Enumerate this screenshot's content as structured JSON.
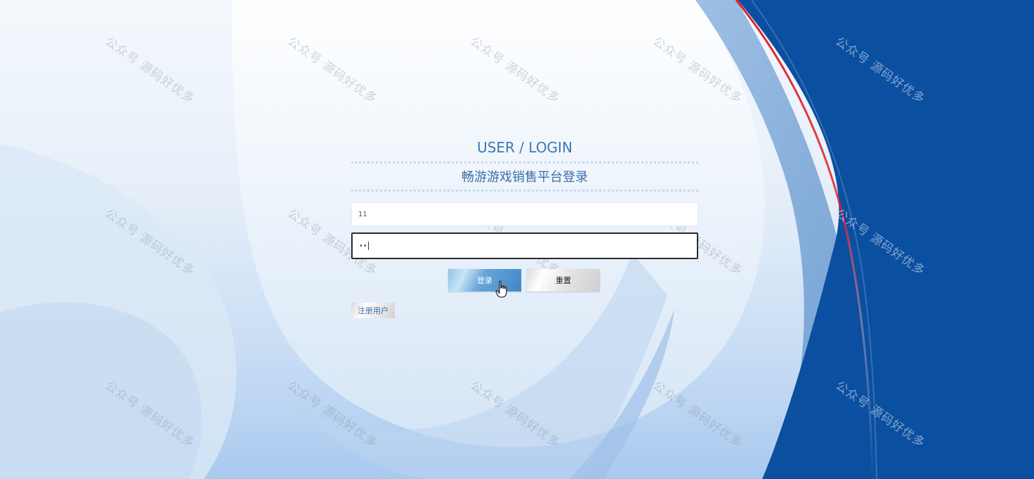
{
  "login": {
    "title_en": "USER / LOGIN",
    "title_cn": "畅游游戏销售平台登录",
    "username_value": "11",
    "password_value": "••",
    "login_button": "登录",
    "reset_button": "重置",
    "register_button": "注册用户"
  },
  "watermark": {
    "text": "公众号 源码好优多"
  },
  "colors": {
    "brand_blue": "#0b4fa0",
    "accent_red": "#e0202a",
    "title_blue": "#3d79b5"
  }
}
